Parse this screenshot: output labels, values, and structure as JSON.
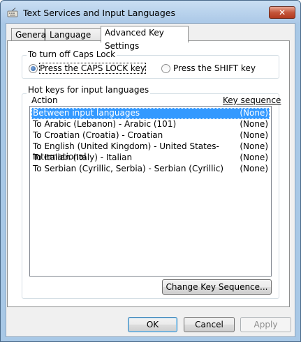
{
  "window": {
    "title": "Text Services and Input Languages",
    "close_glyph": "✕"
  },
  "tabs": [
    {
      "label": "General"
    },
    {
      "label": "Language Bar"
    },
    {
      "label": "Advanced Key Settings"
    }
  ],
  "caps_lock": {
    "group_label": "To turn off Caps Lock",
    "option_caps": "Press the CAPS LOCK key",
    "option_shift": "Press the SHIFT key",
    "selected": "caps"
  },
  "hotkeys": {
    "group_label": "Hot keys for input languages",
    "col_action": "Action",
    "col_sequence": "Key sequence",
    "rows": [
      {
        "action": "Between input languages",
        "sequence": "(None)"
      },
      {
        "action": "To Arabic (Lebanon) - Arabic (101)",
        "sequence": "(None)"
      },
      {
        "action": "To Croatian (Croatia) - Croatian",
        "sequence": "(None)"
      },
      {
        "action": "To English (United Kingdom) - United States-International",
        "sequence": "(None)"
      },
      {
        "action": "To Italian (Italy) - Italian",
        "sequence": "(None)"
      },
      {
        "action": "To Serbian (Cyrillic, Serbia) - Serbian (Cyrillic)",
        "sequence": "(None)"
      }
    ],
    "change_button": "Change Key Sequence..."
  },
  "footer": {
    "ok": "OK",
    "cancel": "Cancel",
    "apply": "Apply"
  }
}
